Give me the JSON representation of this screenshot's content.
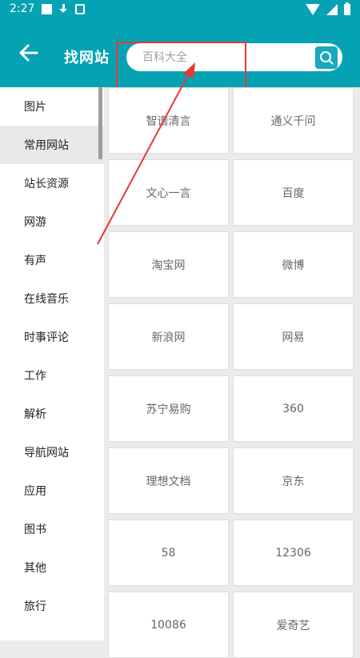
{
  "status_bar": {
    "time": "2:27",
    "left_icons": [
      "square-notification-icon",
      "download-icon",
      "apk-icon"
    ],
    "right_icons": [
      "wifi-icon",
      "signal-icon",
      "battery-icon"
    ]
  },
  "toolbar": {
    "back_icon": "arrow-left-icon",
    "title": "找网站",
    "search": {
      "placeholder": "百科大全",
      "button_icon": "search-icon"
    },
    "color": "#05a2b4"
  },
  "sidebar": {
    "items": [
      {
        "label": "图片",
        "active": false
      },
      {
        "label": "常用网站",
        "active": true
      },
      {
        "label": "站长资源",
        "active": false
      },
      {
        "label": "网游",
        "active": false
      },
      {
        "label": "有声",
        "active": false
      },
      {
        "label": "在线音乐",
        "active": false
      },
      {
        "label": "时事评论",
        "active": false
      },
      {
        "label": "工作",
        "active": false
      },
      {
        "label": "解析",
        "active": false
      },
      {
        "label": "导航网站",
        "active": false
      },
      {
        "label": "应用",
        "active": false
      },
      {
        "label": "图书",
        "active": false
      },
      {
        "label": "其他",
        "active": false
      },
      {
        "label": "旅行",
        "active": false
      }
    ]
  },
  "sites": [
    "智谱清言",
    "通义千问",
    "文心一言",
    "百度",
    "淘宝网",
    "微博",
    "新浪网",
    "网易",
    "苏宁易购",
    "360",
    "理想文档",
    "京东",
    "58",
    "12306",
    "10086",
    "爱奇艺"
  ],
  "annotation": {
    "color": "#e53935"
  }
}
